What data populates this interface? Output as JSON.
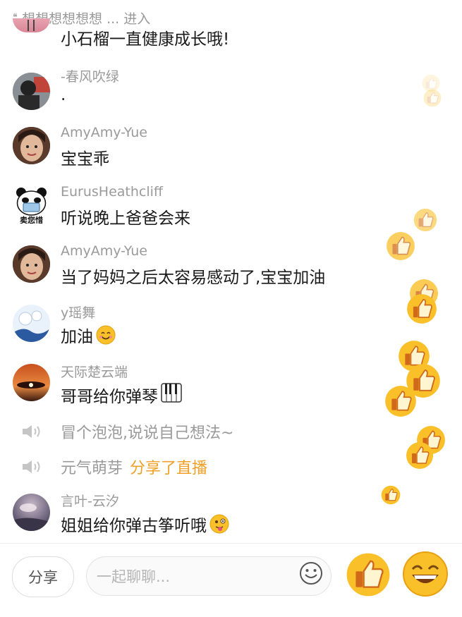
{
  "top_banner": {
    "text": "想想想想想想 ... 进入"
  },
  "messages": [
    {
      "user": "",
      "text": "小石榴一直健康成长哦!"
    },
    {
      "user": "-春风吹绿",
      "text": "."
    },
    {
      "user": "AmyAmy-Yue",
      "text": "宝宝乖"
    },
    {
      "user": "EurusHeathcliff",
      "text": "听说晚上爸爸会来"
    },
    {
      "user": "AmyAmy-Yue",
      "text": "当了妈妈之后太容易感动了,宝宝加油"
    },
    {
      "user": "y瑶舞",
      "text": "加油"
    },
    {
      "user": "天际楚云端",
      "text": "哥哥给你弹琴"
    },
    {
      "user": "言叶-云汐",
      "text": "姐姐给你弹古筝听哦"
    }
  ],
  "system_messages": [
    {
      "text": "冒个泡泡,说说自己想法~",
      "accent": ""
    },
    {
      "text": "元气萌芽",
      "accent": "分享了直播"
    }
  ],
  "panda_caption": "卖您惜",
  "bottom_bar": {
    "share_label": "分享",
    "input_placeholder": "一起聊聊..."
  },
  "colors": {
    "accent": "#f0a028",
    "like_yellow": "#f9c02a",
    "username": "#9a9a9a"
  }
}
